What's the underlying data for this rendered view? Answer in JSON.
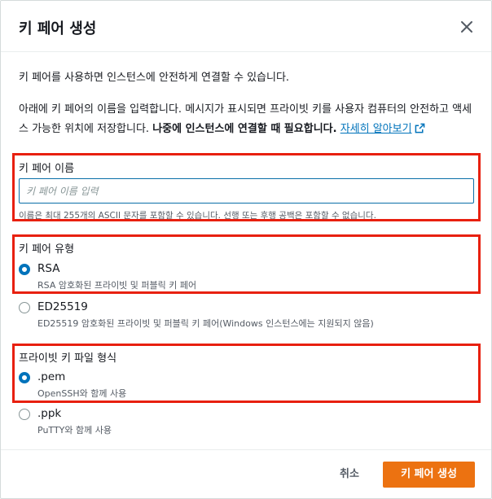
{
  "dialog": {
    "title": "키 페어 생성",
    "intro": "키 페어를 사용하면 인스턴스에 안전하게 연결할 수 있습니다.",
    "desc_part1": "아래에 키 페어의 이름을 입력합니다. 메시지가 표시되면 프라이빗 키를 사용자 컴퓨터의 안전하고 액세스 가능한 위치에 저장합니다. ",
    "desc_bold": "나중에 인스턴스에 연결할 때 필요합니다.",
    "learn_more": "자세히 알아보기"
  },
  "name_section": {
    "label": "키 페어 이름",
    "placeholder": "키 페어 이름 입력",
    "value": "",
    "hint": "이름은 최대 255개의 ASCII 문자를 포함할 수 있습니다. 선행 또는 후행 공백은 포함할 수 없습니다."
  },
  "type_section": {
    "label": "키 페어 유형",
    "options": [
      {
        "label": "RSA",
        "desc": "RSA 암호화된 프라이빗 및 퍼블릭 키 페어",
        "selected": true
      },
      {
        "label": "ED25519",
        "desc": "ED25519 암호화된 프라이빗 및 퍼블릭 키 페어(Windows 인스턴스에는 지원되지 않음)",
        "selected": false
      }
    ]
  },
  "format_section": {
    "label": "프라이빗 키 파일 형식",
    "options": [
      {
        "label": ".pem",
        "desc": "OpenSSH와 함께 사용",
        "selected": true
      },
      {
        "label": ".ppk",
        "desc": "PuTTY와 함께 사용",
        "selected": false
      }
    ]
  },
  "footer": {
    "cancel_label": "취소",
    "create_label": "키 페어 생성"
  },
  "colors": {
    "accent": "#0073bb",
    "primary_button": "#ec7211",
    "highlight_border": "#e8200f"
  },
  "icons": [
    "close-icon",
    "external-link-icon"
  ]
}
